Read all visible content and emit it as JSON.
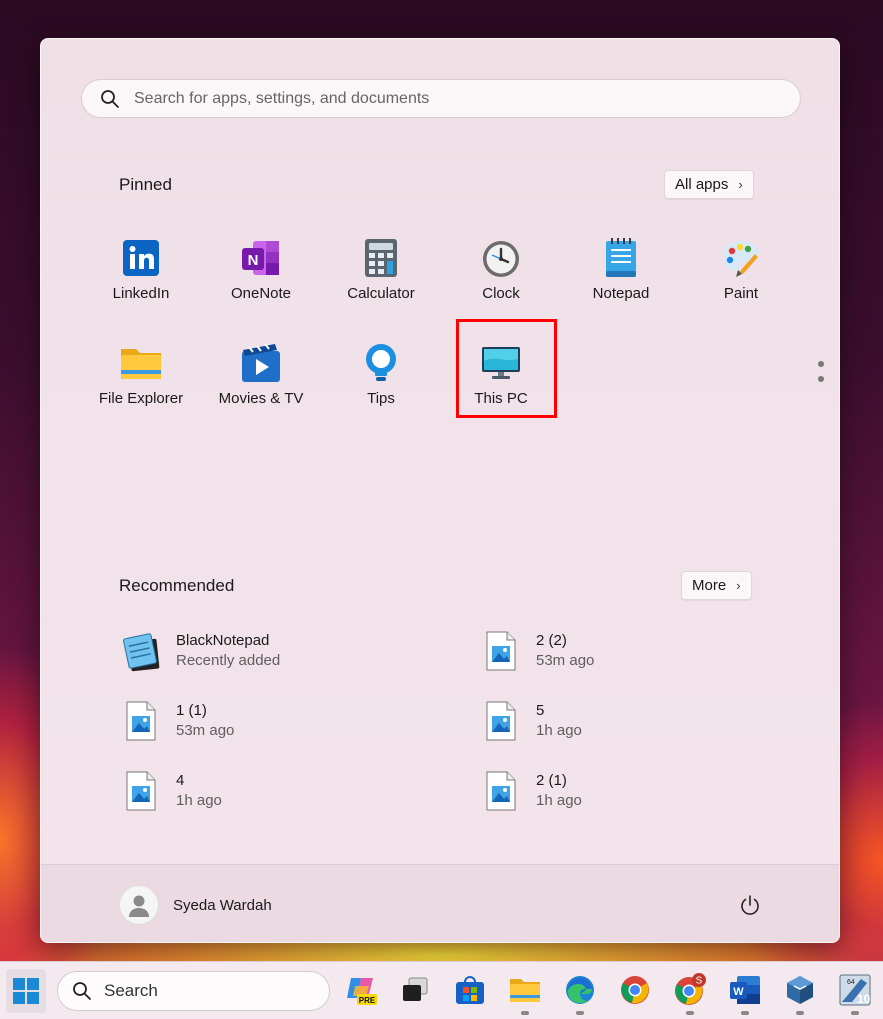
{
  "search": {
    "placeholder": "Search for apps, settings, and documents"
  },
  "pinned": {
    "title": "Pinned",
    "all_apps_label": "All apps",
    "apps": [
      {
        "label": "LinkedIn",
        "icon": "linkedin-icon"
      },
      {
        "label": "OneNote",
        "icon": "onenote-icon"
      },
      {
        "label": "Calculator",
        "icon": "calculator-icon"
      },
      {
        "label": "Clock",
        "icon": "clock-icon"
      },
      {
        "label": "Notepad",
        "icon": "notepad-icon"
      },
      {
        "label": "Paint",
        "icon": "paint-icon"
      },
      {
        "label": "File Explorer",
        "icon": "folder-icon"
      },
      {
        "label": "Movies & TV",
        "icon": "movies-icon"
      },
      {
        "label": "Tips",
        "icon": "lightbulb-icon"
      },
      {
        "label": "This PC",
        "icon": "monitor-icon"
      }
    ]
  },
  "recommended": {
    "title": "Recommended",
    "more_label": "More",
    "items": [
      {
        "name": "BlackNotepad",
        "sub": "Recently added",
        "icon": "notepad-stack-icon"
      },
      {
        "name": "2 (2)",
        "sub": "53m ago",
        "icon": "image-file-icon"
      },
      {
        "name": "1 (1)",
        "sub": "53m ago",
        "icon": "image-file-icon"
      },
      {
        "name": "5",
        "sub": "1h ago",
        "icon": "image-file-icon"
      },
      {
        "name": "4",
        "sub": "1h ago",
        "icon": "image-file-icon"
      },
      {
        "name": "2 (1)",
        "sub": "1h ago",
        "icon": "image-file-icon"
      }
    ]
  },
  "user": {
    "name": "Syeda Wardah"
  },
  "taskbar": {
    "search_label": "Search",
    "copilot_badge": "PRE",
    "chrome_profile_badge": "S",
    "vm_badge_top": "64",
    "vm_badge_num": "10",
    "icons": [
      "windows-start-icon",
      "copilot-icon",
      "task-view-icon",
      "store-icon",
      "file-explorer-icon",
      "edge-icon",
      "chrome-icon",
      "chrome-profile-icon",
      "word-icon",
      "virtualbox-icon",
      "vm-app-icon"
    ]
  },
  "colors": {
    "highlight": "#ff0000",
    "accent": "#0067c0"
  }
}
